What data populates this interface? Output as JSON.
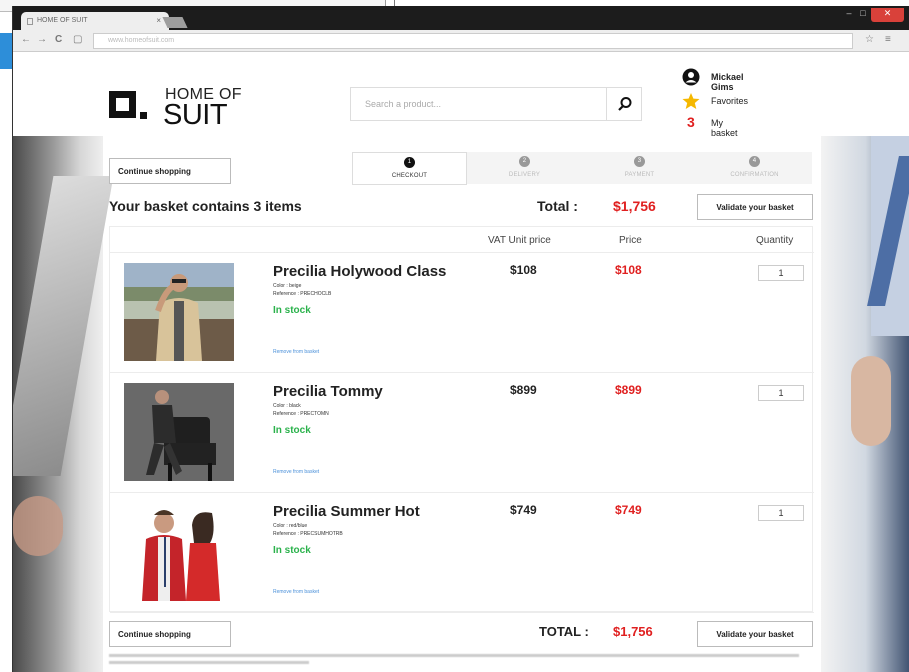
{
  "browser": {
    "tab_title": "HOME OF SUIT",
    "tab_close": "×",
    "url": "www.homeofsuit.com",
    "window_controls": {
      "minimize": "–",
      "maximize": "□",
      "close": "✕"
    },
    "nav": {
      "back": "←",
      "forward": "→",
      "reload": "C",
      "page": "▢"
    },
    "toolbar_icons": {
      "star": "☆",
      "menu": "≡"
    }
  },
  "logo": {
    "line1": "HOME OF",
    "line2": "SUIT"
  },
  "search": {
    "placeholder": "Search a product..."
  },
  "user_menu": {
    "name": "Mickael Gims",
    "favorites": "Favorites",
    "basket_count": "3",
    "basket_label": "My basket"
  },
  "steps": [
    {
      "num": "1",
      "label": "CHECKOUT",
      "active": true
    },
    {
      "num": "2",
      "label": "DELIVERY",
      "active": false
    },
    {
      "num": "3",
      "label": "PAYMENT",
      "active": false
    },
    {
      "num": "4",
      "label": "CONFIRMATION",
      "active": false
    }
  ],
  "actions": {
    "continue_shopping": "Continue shopping",
    "validate_basket": "Validate your basket"
  },
  "summary": {
    "count_text": "Your basket contains 3 items",
    "total_label": "Total :",
    "total_value": "$1,756"
  },
  "table": {
    "headers": {
      "vat": "VAT Unit price",
      "price": "Price",
      "quantity": "Quantity"
    },
    "items": [
      {
        "name": "Precilia Holywood Class",
        "color": "Color : beige",
        "reference": "Reference : PRECHOCLB",
        "stock": "In stock",
        "remove": "Remove from basket",
        "vat_price": "$108",
        "price": "$108",
        "quantity": "1"
      },
      {
        "name": "Precilia Tommy",
        "color": "Color : black",
        "reference": "Reference : PRECTOMN",
        "stock": "In stock",
        "remove": "Remove from basket",
        "vat_price": "$899",
        "price": "$899",
        "quantity": "1"
      },
      {
        "name": "Precilia Summer Hot",
        "color": "Color : red/blue",
        "reference": "Reference : PRECSUMHOTRB",
        "stock": "In stock",
        "remove": "Remove from basket",
        "vat_price": "$749",
        "price": "$749",
        "quantity": "1"
      }
    ]
  },
  "totals": {
    "label": "TOTAL :",
    "value": "$1,756"
  },
  "colors": {
    "accent_red": "#e02020",
    "stock_green": "#2bb24c",
    "link_blue": "#4a90d9",
    "close_red": "#d9413a"
  }
}
